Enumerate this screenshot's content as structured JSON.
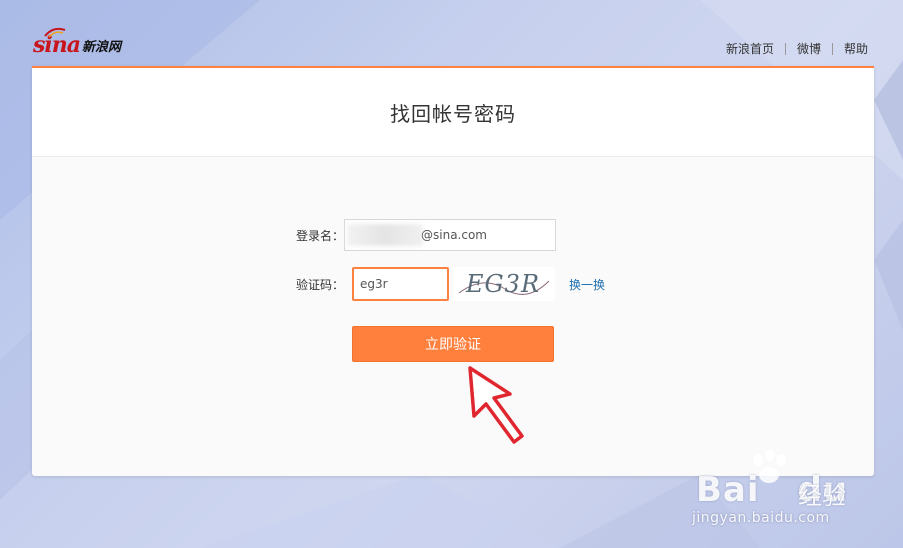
{
  "header": {
    "logo_text": "sina",
    "logo_cn": "新浪网",
    "nav": [
      {
        "label": "新浪首页"
      },
      {
        "label": "微博"
      },
      {
        "label": "帮助"
      }
    ]
  },
  "card": {
    "title": "找回帐号密码"
  },
  "form": {
    "login_label": "登录名：",
    "login_suffix": "@sina.com",
    "captcha_label": "验证码：",
    "captcha_value": "eg3r",
    "captcha_image_text": "EG3R",
    "refresh_label": "换一换",
    "submit_label": "立即验证"
  },
  "watermark": {
    "brand": "Bai",
    "brand2": "du",
    "cn": "经验",
    "url": "jingyan.baidu.com"
  },
  "colors": {
    "accent": "#ff7f3d",
    "link": "#1f6fb0",
    "arrow": "#e0262e"
  }
}
